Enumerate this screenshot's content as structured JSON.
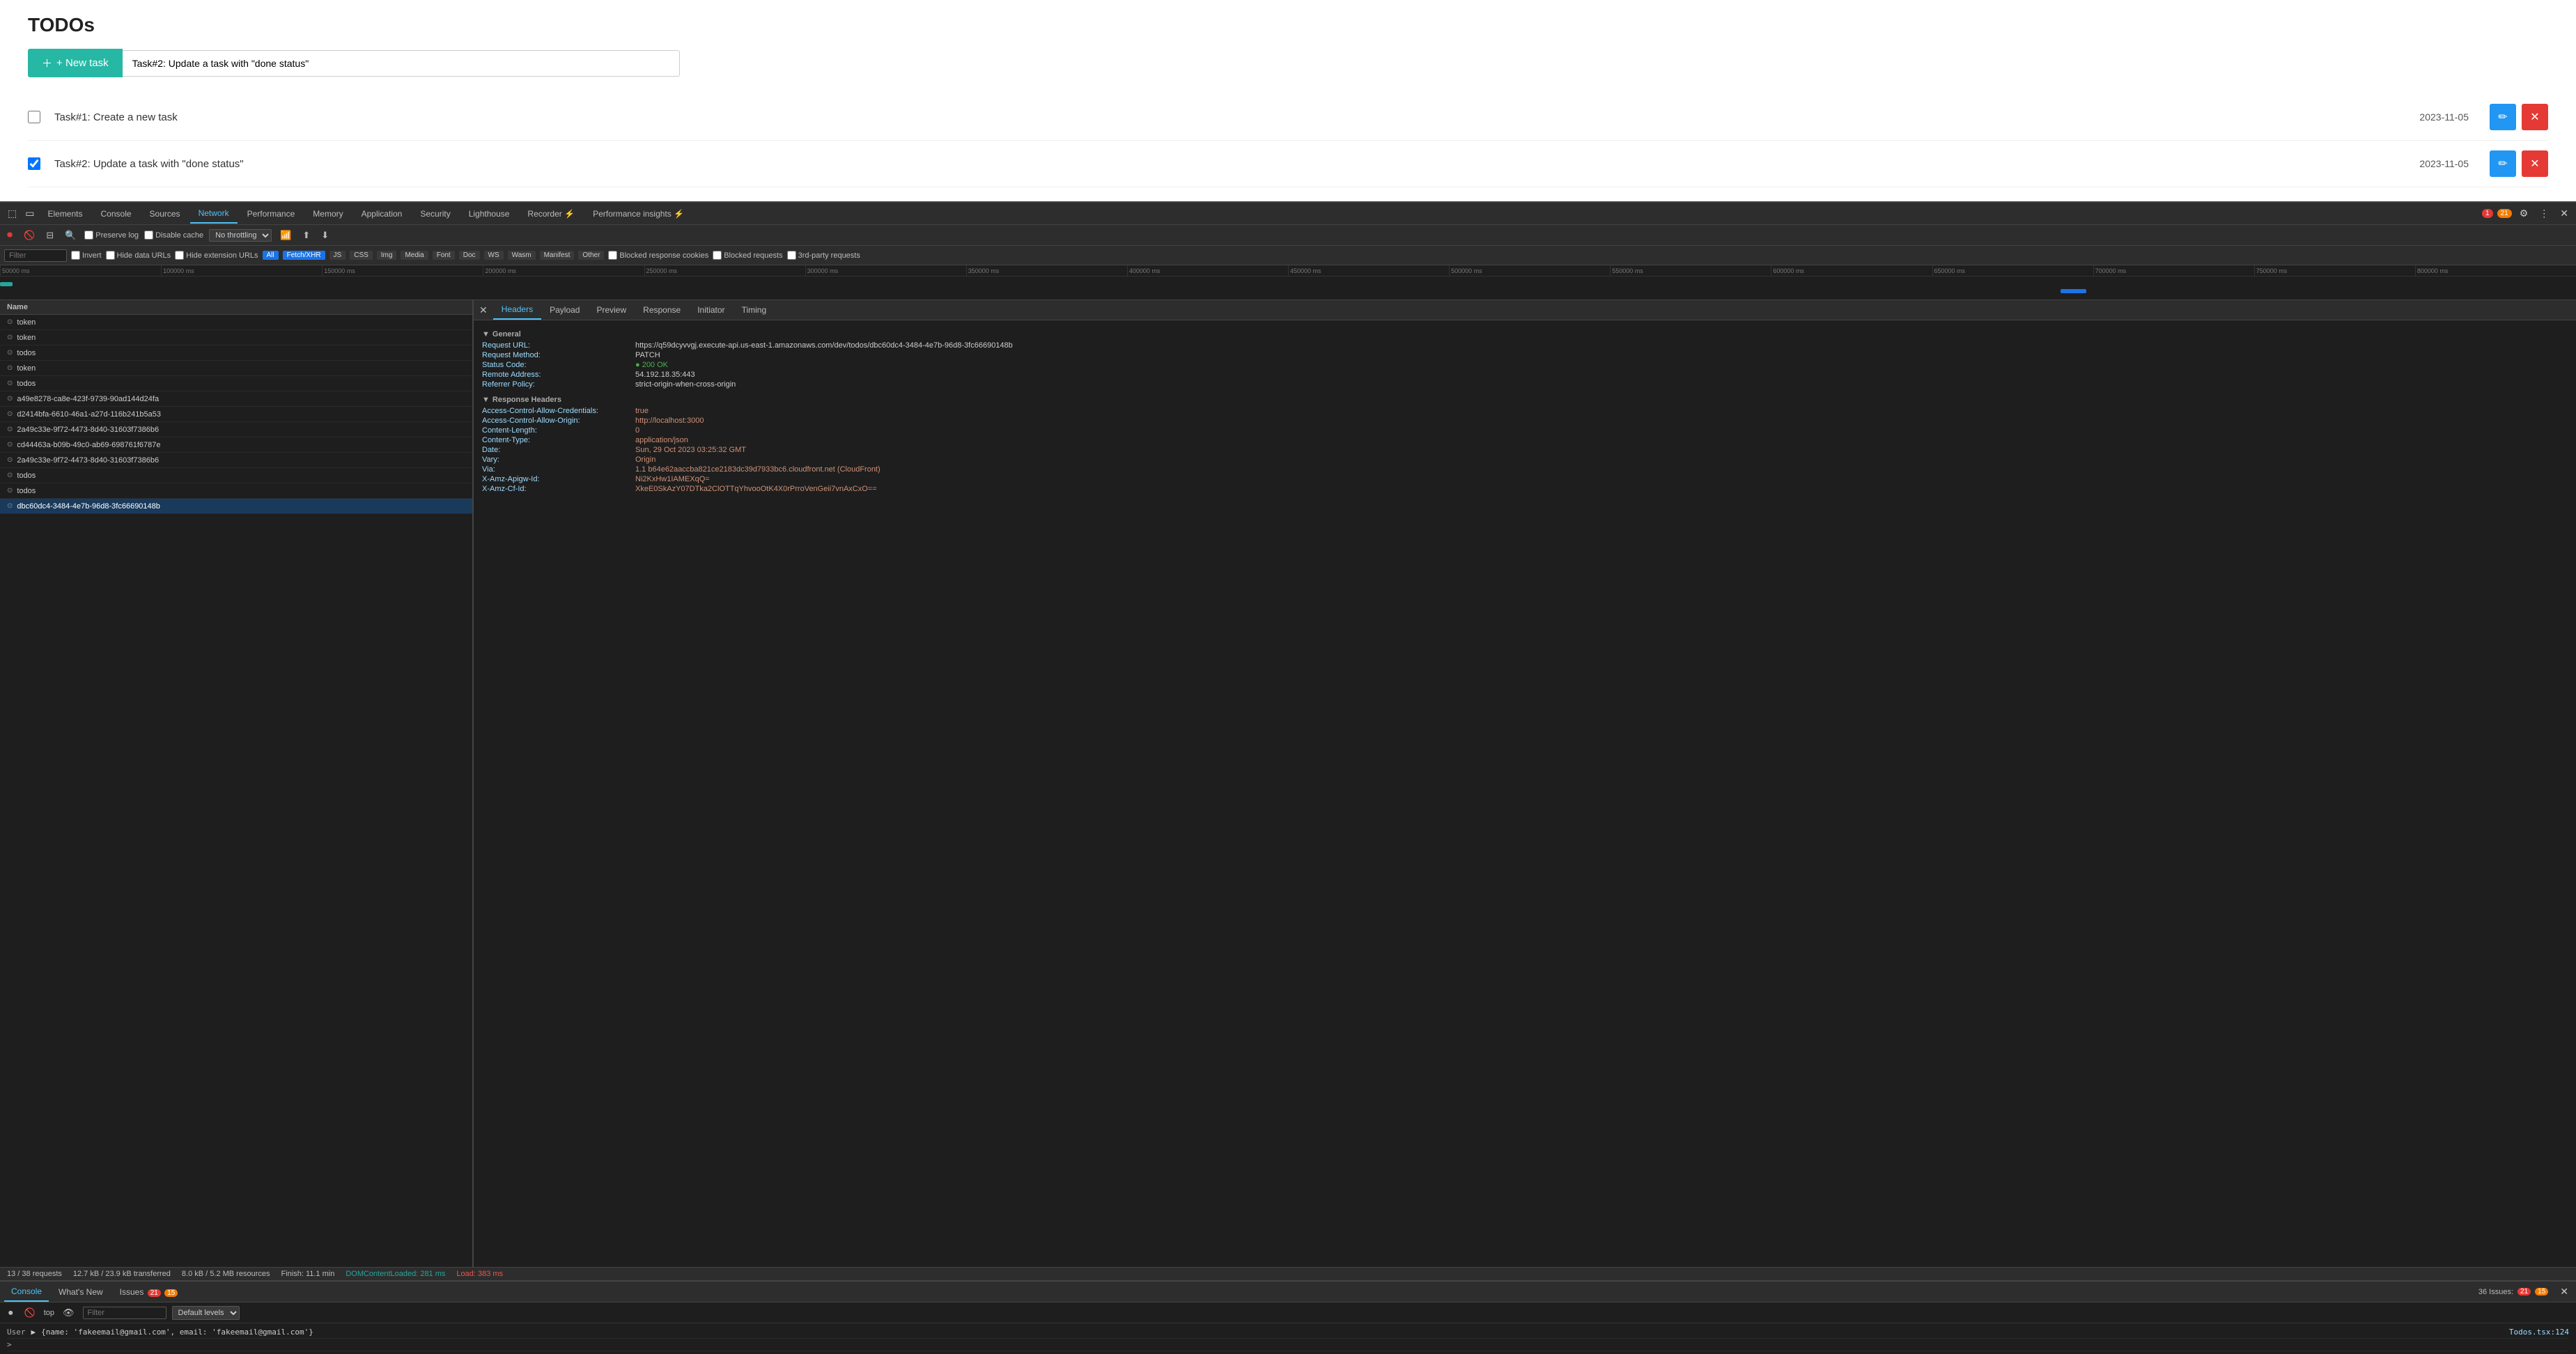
{
  "app": {
    "title": "TODOs",
    "new_task_btn": "+ New task",
    "new_task_placeholder": "Task#2: Update a task with \"done status\""
  },
  "tasks": [
    {
      "id": 1,
      "label": "Task#1: Create a new task",
      "date": "2023-11-05",
      "checked": false
    },
    {
      "id": 2,
      "label": "Task#2: Update a task with \"done status\"",
      "date": "2023-11-05",
      "checked": true
    }
  ],
  "devtools": {
    "tabs": [
      "Elements",
      "Console",
      "Sources",
      "Network",
      "Performance",
      "Memory",
      "Application",
      "Security",
      "Lighthouse",
      "Recorder",
      "Performance insights"
    ],
    "active_tab": "Network",
    "badge_red": "1",
    "badge_yellow": "21",
    "toolbar": {
      "preserve_log": "Preserve log",
      "disable_cache": "Disable cache",
      "throttling": "No throttling"
    },
    "filter": {
      "placeholder": "Filter",
      "invert": "Invert",
      "hide_data_urls": "Hide data URLs",
      "hide_ext_urls": "Hide extension URLs"
    },
    "filter_tags": [
      "All",
      "Fetch/XHR",
      "JS",
      "CSS",
      "Img",
      "Media",
      "Font",
      "Doc",
      "WS",
      "Wasm",
      "Manifest",
      "Other"
    ],
    "filter_tags_right": [
      "Blocked response cookies",
      "Blocked requests",
      "3rd-party requests"
    ],
    "timeline_ticks": [
      "50000 ms",
      "100000 ms",
      "150000 ms",
      "200000 ms",
      "250000 ms",
      "300000 ms",
      "350000 ms",
      "400000 ms",
      "450000 ms",
      "500000 ms",
      "550000 ms",
      "600000 ms",
      "650000 ms",
      "700000 ms",
      "750000 ms",
      "800000 ms"
    ],
    "req_list": {
      "header": "Name",
      "items": [
        {
          "name": "token",
          "icon": "⊙"
        },
        {
          "name": "token",
          "icon": "⊙"
        },
        {
          "name": "todos",
          "icon": "⊙"
        },
        {
          "name": "token",
          "icon": "⊙"
        },
        {
          "name": "todos",
          "icon": "⊙"
        },
        {
          "name": "a49e8278-ca8e-423f-9739-90ad144d24fa",
          "icon": "⊙"
        },
        {
          "name": "d2414bfa-6610-46a1-a27d-116b241b5a53",
          "icon": "⊙"
        },
        {
          "name": "2a49c33e-9f72-4473-8d40-31603f7386b6",
          "icon": "⊙"
        },
        {
          "name": "cd44463a-b09b-49c0-ab69-698761f6787e",
          "icon": "⊙"
        },
        {
          "name": "2a49c33e-9f72-4473-8d40-31603f7386b6",
          "icon": "⊙"
        },
        {
          "name": "todos",
          "icon": "⊙"
        },
        {
          "name": "todos",
          "icon": "⊙"
        },
        {
          "name": "dbc60dc4-3484-4e7b-96d8-3fc66690148b",
          "icon": "⊙",
          "active": true
        }
      ]
    },
    "headers_panel": {
      "tabs": [
        "Headers",
        "Payload",
        "Preview",
        "Response",
        "Initiator",
        "Timing"
      ],
      "active_tab": "Headers",
      "general": {
        "title": "General",
        "request_url": {
          "key": "Request URL:",
          "val": "https://q59dcyvvgj.execute-api.us-east-1.amazonaws.com/dev/todos/dbc60dc4-3484-4e7b-96d8-3fc66690148b"
        },
        "request_method": {
          "key": "Request Method:",
          "val": "PATCH"
        },
        "status_code": {
          "key": "Status Code:",
          "val": "200 OK"
        },
        "remote_address": {
          "key": "Remote Address:",
          "val": "54.192.18.35:443"
        },
        "referrer_policy": {
          "key": "Referrer Policy:",
          "val": "strict-origin-when-cross-origin"
        }
      },
      "response_headers": {
        "title": "Response Headers",
        "items": [
          {
            "key": "Access-Control-Allow-Credentials:",
            "val": "true"
          },
          {
            "key": "Access-Control-Allow-Origin:",
            "val": "http://localhost:3000"
          },
          {
            "key": "Content-Length:",
            "val": "0"
          },
          {
            "key": "Content-Type:",
            "val": "application/json"
          },
          {
            "key": "Date:",
            "val": "Sun, 29 Oct 2023 03:25:32 GMT"
          },
          {
            "key": "Vary:",
            "val": "Origin"
          },
          {
            "key": "Via:",
            "val": "1.1 b64e62aaccba821ce2183dc39d7933bc6.cloudfront.net (CloudFront)"
          },
          {
            "key": "X-Amz-Apigw-Id:",
            "val": "Ni2KxHw1IAMEXqQ="
          },
          {
            "key": "X-Amz-Cf-Id:",
            "val": "XkeE0SkAzY07DTka2ClOTTqYhvooOtK4X0rPrroVenGeii7vnAxCxO=="
          }
        ]
      }
    },
    "status_bar": {
      "requests": "13 / 38 requests",
      "transferred": "12.7 kB / 23.9 kB transferred",
      "resources": "8.0 kB / 5.2 MB resources",
      "finish": "Finish: 11.1 min",
      "dom_content_loaded": "DOMContentLoaded: 281 ms",
      "load": "Load: 383 ms"
    },
    "console": {
      "tabs": [
        "Console",
        "What's New",
        "Issues"
      ],
      "active_tab": "Console",
      "issues_badge": "21",
      "issues_badge2": "15",
      "filter_placeholder": "Filter",
      "level_select": "Default levels",
      "issues_count": "36 Issues:",
      "prompt_label": "top",
      "log_entry": "User ▶ {name: 'fakeemail@gmail.com', email: 'fakeemail@gmail.com'}",
      "log_link": "Todos.tsx:124",
      "console_chevron": ">"
    }
  }
}
